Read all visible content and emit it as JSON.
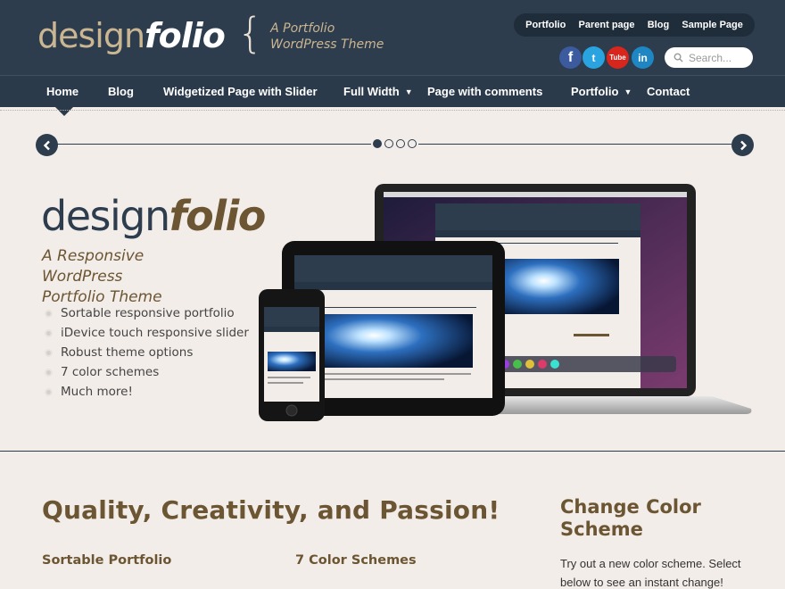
{
  "header": {
    "logo_design": "design",
    "logo_folio": "folio",
    "tagline_line1": "A Portfolio",
    "tagline_line2": "WordPress Theme",
    "top_nav": [
      "Portfolio",
      "Parent page",
      "Blog",
      "Sample Page"
    ],
    "social": {
      "facebook": "f",
      "twitter": "t",
      "youtube": "Tube",
      "linkedin": "in"
    },
    "search_placeholder": "Search..."
  },
  "main_nav": {
    "items": [
      "Home",
      "Blog",
      "Widgetized Page with Slider",
      "Full Width",
      "Page with comments",
      "Portfolio",
      "Contact"
    ],
    "dropdown_caret": "▼"
  },
  "slider": {
    "slide_count": 4,
    "active_slide": 1,
    "hero_design": "design",
    "hero_folio": "folio",
    "hero_tagline_line1": "A Responsive WordPress",
    "hero_tagline_line2": "Portfolio Theme",
    "features": [
      "Sortable responsive portfolio",
      "iDevice touch responsive slider",
      "Robust theme options",
      "7 color schemes",
      "Much more!"
    ]
  },
  "content": {
    "heading": "Quality, Creativity, and Passion!",
    "col1_heading": "Sortable Portfolio",
    "col2_heading": "7 Color Schemes",
    "sidebar_heading": "Change Color Scheme",
    "sidebar_text": "Try out a new color scheme. Select below to see an instant change!"
  },
  "colors": {
    "header_bg": "#2d3d4e",
    "accent_tan": "#cbb692",
    "accent_brown": "#6b5532",
    "page_bg": "#f3ede9"
  }
}
